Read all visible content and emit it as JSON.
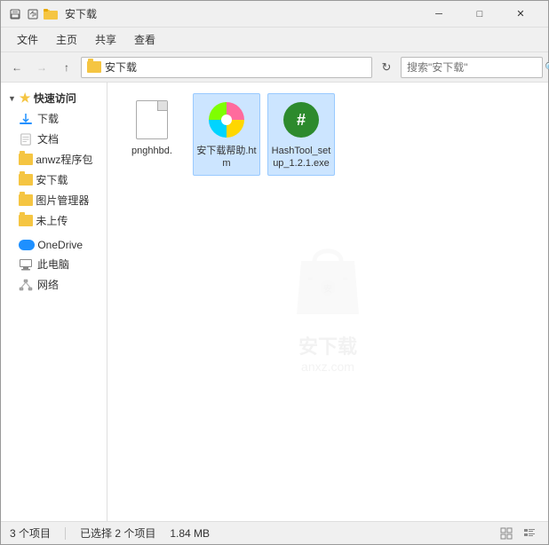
{
  "titleBar": {
    "title": "安下载",
    "icons": [
      "save-icon",
      "undo-icon",
      "folder-icon"
    ],
    "minimize": "─",
    "maximize": "□",
    "close": "✕"
  },
  "menuBar": {
    "items": [
      "文件",
      "主页",
      "共享",
      "查看"
    ]
  },
  "addressBar": {
    "back": "←",
    "forward": "→",
    "up": "↑",
    "path": "安下载",
    "refresh": "↻",
    "searchPlaceholder": "搜索\"安下载\""
  },
  "sidebar": {
    "quickAccess": {
      "label": "快速访问",
      "items": [
        {
          "label": "下载",
          "icon": "download-icon"
        },
        {
          "label": "文档",
          "icon": "document-icon"
        },
        {
          "label": "anwz程序包",
          "icon": "folder-icon"
        },
        {
          "label": "安下载",
          "icon": "folder-icon"
        },
        {
          "label": "图片管理器",
          "icon": "folder-icon"
        },
        {
          "label": "未上传",
          "icon": "folder-icon"
        }
      ]
    },
    "oneDrive": {
      "label": "OneDrive",
      "icon": "onedrive-icon"
    },
    "thisPC": {
      "label": "此电脑",
      "icon": "computer-icon"
    },
    "network": {
      "label": "网络",
      "icon": "network-icon"
    }
  },
  "files": [
    {
      "name": "pnghhbd.",
      "type": "generic",
      "selected": false
    },
    {
      "name": "安下载帮助.htm",
      "type": "htm",
      "selected": true
    },
    {
      "name": "HashTool_setup_1.2.1.exe",
      "type": "exe",
      "selected": true
    }
  ],
  "watermark": {
    "text": "安下载",
    "subtext": "anxz.com"
  },
  "statusBar": {
    "itemCount": "3 个项目",
    "selectedCount": "已选择 2 个项目",
    "selectedSize": "1.84 MB"
  }
}
